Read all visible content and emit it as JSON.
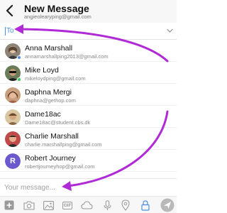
{
  "header": {
    "title": "New Message",
    "subtitle": "angieolearyping@gmail.com"
  },
  "recipient": {
    "label": "To"
  },
  "contacts": [
    {
      "name": "Anna Marshall",
      "email": "annamarshallping2013@gmail.com",
      "status_color": "#4a90e2"
    },
    {
      "name": "Mike Loyd",
      "email": "mikeloydping@gmail.com",
      "status_color": "#34c759"
    },
    {
      "name": "Daphna Mergi",
      "email": "daphna@gethop.com",
      "status_color": null
    },
    {
      "name": "Dame18ac",
      "email": "Dame18ac@student.cbs.dk",
      "status_color": null
    },
    {
      "name": "Charlie Marshall",
      "email": "charlie.marshallping@gmail.com",
      "status_color": null
    },
    {
      "name": "Robert Journey",
      "email": "robertjourneyhop@gmail.com",
      "status_color": null,
      "initial": "R"
    },
    {
      "name": "",
      "email": "",
      "status_color": null
    }
  ],
  "composer": {
    "placeholder": "Your message..."
  },
  "toolbar": {
    "gif_label": "GIF",
    "icons": [
      "add-icon",
      "camera-icon",
      "image-icon",
      "gif-icon",
      "cloud-icon",
      "microphone-icon",
      "location-icon",
      "lock-icon",
      "send-icon"
    ]
  },
  "colors": {
    "accent": "#4a90e2",
    "annotation_arrow": "#b02bd6",
    "online": "#34c759"
  }
}
